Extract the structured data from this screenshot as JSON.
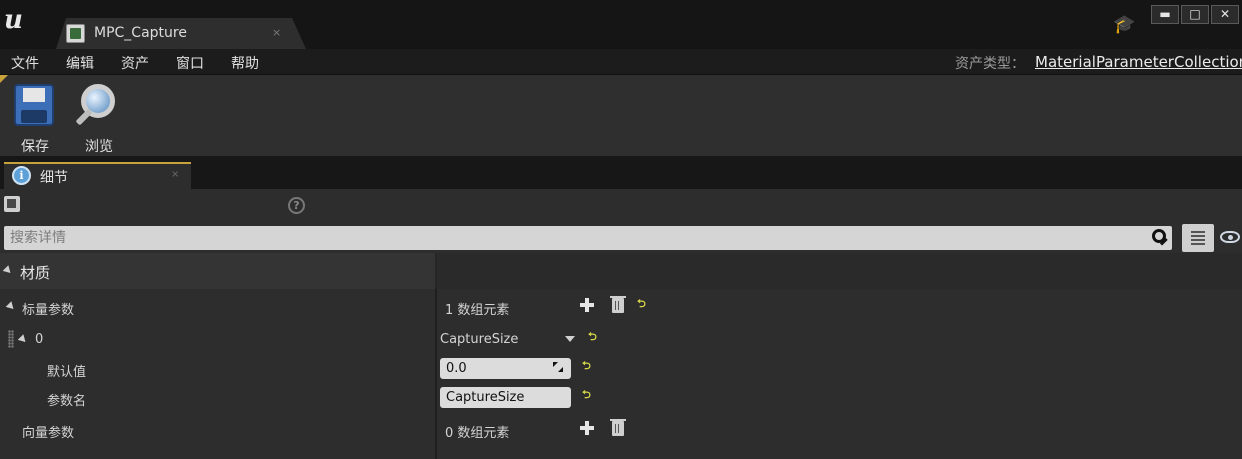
{
  "window": {
    "logo": "u",
    "tab_title": "MPC_Capture",
    "tab_close": "×",
    "buttons": {
      "minimize": "▬",
      "maximize": "□",
      "close": "✕"
    }
  },
  "menu": {
    "items": [
      "文件",
      "编辑",
      "资产",
      "窗口",
      "帮助"
    ],
    "asset_type_label": "资产类型：",
    "asset_type_value": "MaterialParameterCollection"
  },
  "toolbar": {
    "save_label": "保存",
    "browse_label": "浏览"
  },
  "details_tab": {
    "label": "细节",
    "icon_glyph": "i",
    "close": "×"
  },
  "details": {
    "help_glyph": "?",
    "search_placeholder": "搜索详情",
    "category": "材质",
    "scalar_params": {
      "label": "标量参数",
      "count_text": "1 数组元素"
    },
    "element": {
      "index": "0",
      "name_value": "CaptureSize",
      "default_label": "默认值",
      "default_value": "0.0",
      "param_name_label": "参数名",
      "param_name_value": "CaptureSize"
    },
    "vector_params": {
      "label": "向量参数",
      "count_text": "0 数组元素"
    },
    "reset_glyph": "⮌"
  },
  "colors": {
    "accent": "#c8a23a",
    "reset": "#d8d84a",
    "background": "#2d2d2d"
  }
}
